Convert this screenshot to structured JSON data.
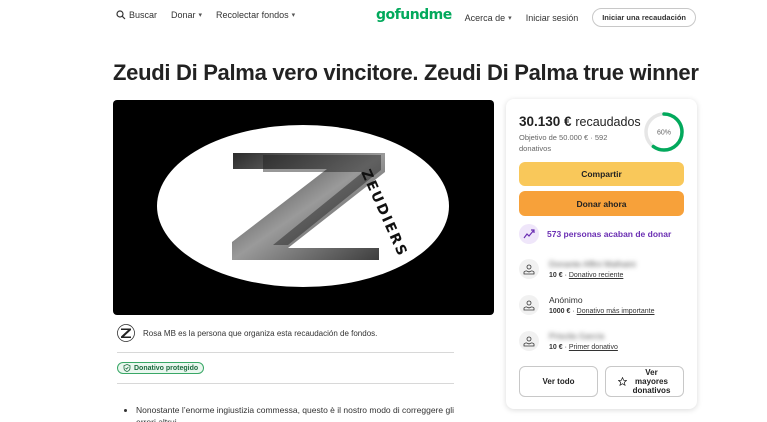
{
  "header": {
    "search": "Buscar",
    "donate": "Donar",
    "fundraise": "Recolectar fondos",
    "logo": "gofundme",
    "about": "Acerca de",
    "login": "Iniciar sesión",
    "start": "Iniciar una recaudación"
  },
  "campaign": {
    "title": "Zeudi Di Palma vero vincitore. Zeudi Di Palma true winner",
    "organizer_text": "Rosa MB es la persona que organiza esta recaudación de fondos.",
    "protected_badge": "Donativo protegido",
    "description": "Nonostante l’enorme ingiustizia commessa, questo è il nostro modo di correggere gli errori altrui"
  },
  "stats": {
    "raised": "30.130 €",
    "raised_suffix": "recaudados",
    "goal_line": "Objetivo de 50.000 € · 592 donativos",
    "percent_label": "60%",
    "percent_value": 0.6
  },
  "actions": {
    "share": "Compartir",
    "donate_now": "Donar ahora",
    "see_all": "Ver todo",
    "see_top": "Ver mayores donativos"
  },
  "recent": {
    "text": "573 personas acaban de donar"
  },
  "donations": [
    {
      "name": "Donante Affini Malhaini",
      "amount": "10 €",
      "label": "Donativo reciente",
      "blurred": true
    },
    {
      "name": "Anónimo",
      "amount": "1000 €",
      "label": "Donativo más importante",
      "blurred": false
    },
    {
      "name": "Priscila García",
      "amount": "10 €",
      "label": "Primer donativo",
      "blurred": true
    }
  ],
  "colors": {
    "brand": "#02a95c",
    "share": "#f9c85a",
    "donate": "#f7a13a",
    "accent_purple": "#6b2fb3"
  }
}
